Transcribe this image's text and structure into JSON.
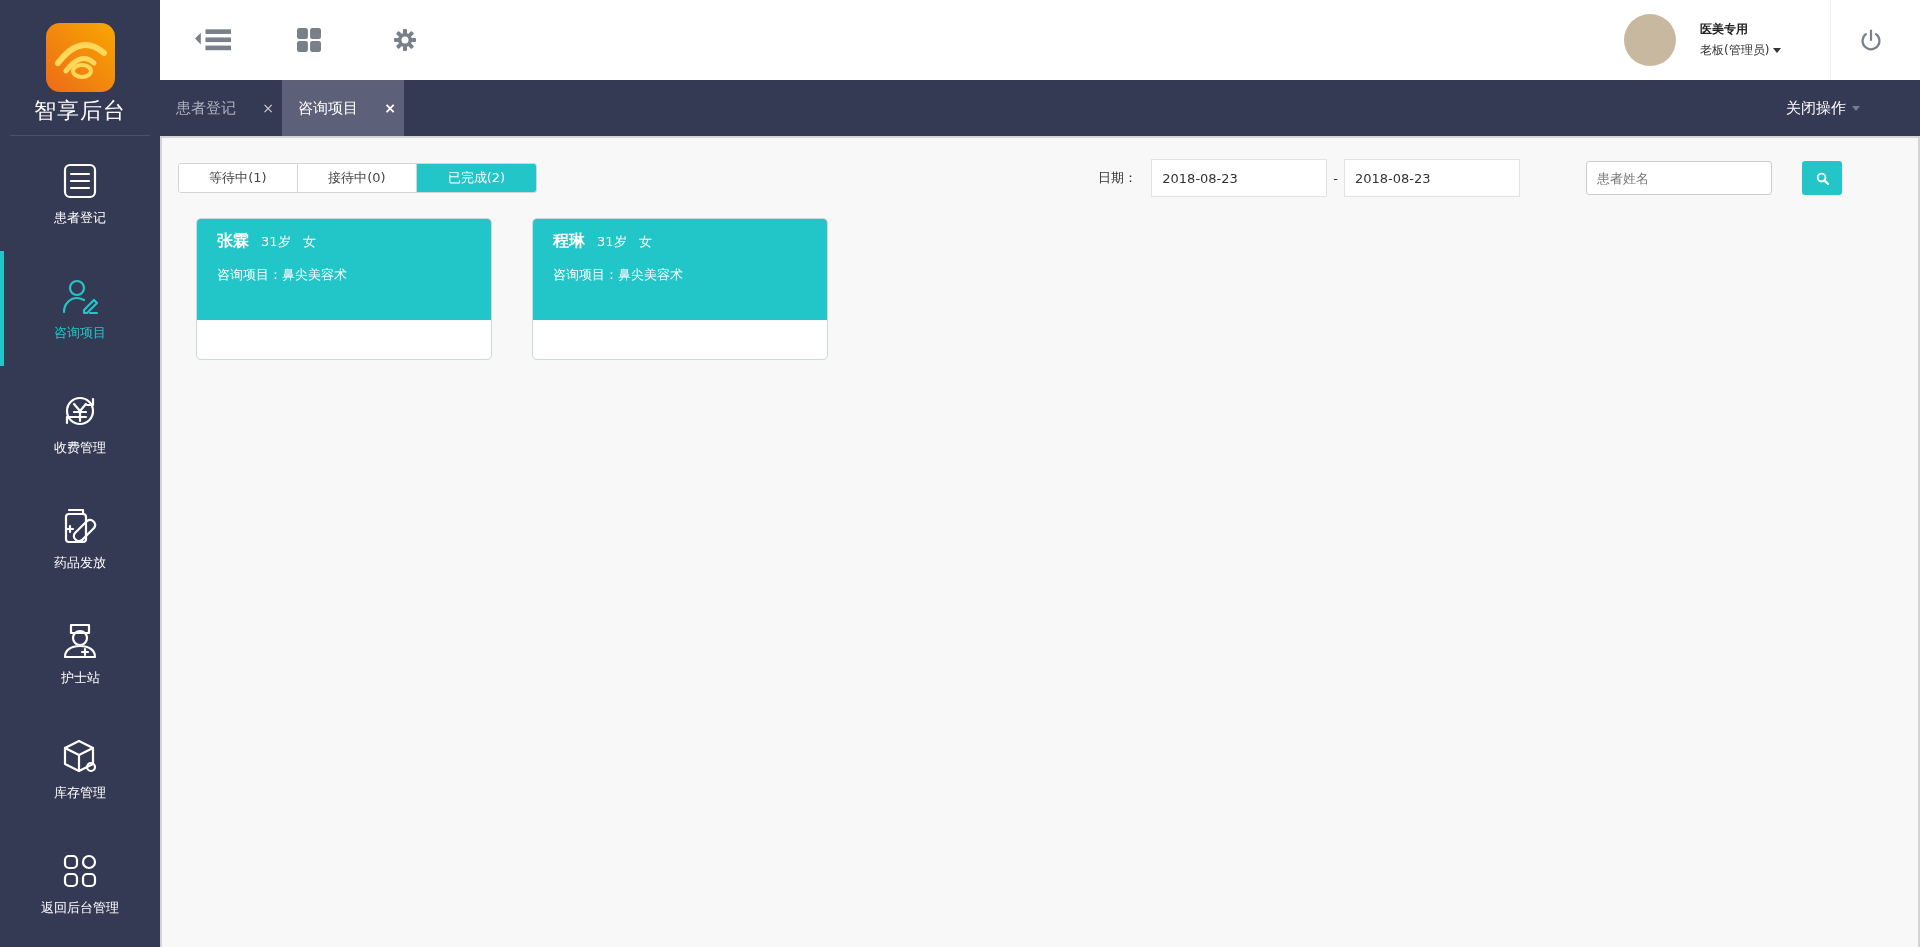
{
  "logo": {
    "title": "智享后台"
  },
  "sidebar": {
    "items": [
      {
        "label": "患者登记",
        "selected": false
      },
      {
        "label": "咨询项目",
        "selected": true
      },
      {
        "label": "收费管理",
        "selected": false
      },
      {
        "label": "药品发放",
        "selected": false
      },
      {
        "label": "护士站",
        "selected": false
      },
      {
        "label": "库存管理",
        "selected": false
      },
      {
        "label": "返回后台管理",
        "selected": false
      }
    ]
  },
  "user": {
    "name": "医美专用",
    "role": "老板(管理员)"
  },
  "tabs": [
    {
      "label": "患者登记",
      "selected": false,
      "close": "×"
    },
    {
      "label": "咨询项目",
      "selected": true,
      "close": "×"
    }
  ],
  "close_menu": "关闭操作",
  "filters": {
    "status_tabs": [
      {
        "label": "等待中(1)",
        "selected": false
      },
      {
        "label": "接待中(0)",
        "selected": false
      },
      {
        "label": "已完成(2)",
        "selected": true
      }
    ],
    "date_label": "日期：",
    "date_from": "2018-08-23",
    "separator": "-",
    "date_to": "2018-08-23",
    "search": {
      "placeholder": "患者姓名"
    }
  },
  "cards": [
    {
      "name": "张霖",
      "age": "31岁",
      "gender": "女",
      "project": "咨询项目：鼻尖美容术"
    },
    {
      "name": "程琳",
      "age": "31岁",
      "gender": "女",
      "project": "咨询项目：鼻尖美容术"
    }
  ]
}
